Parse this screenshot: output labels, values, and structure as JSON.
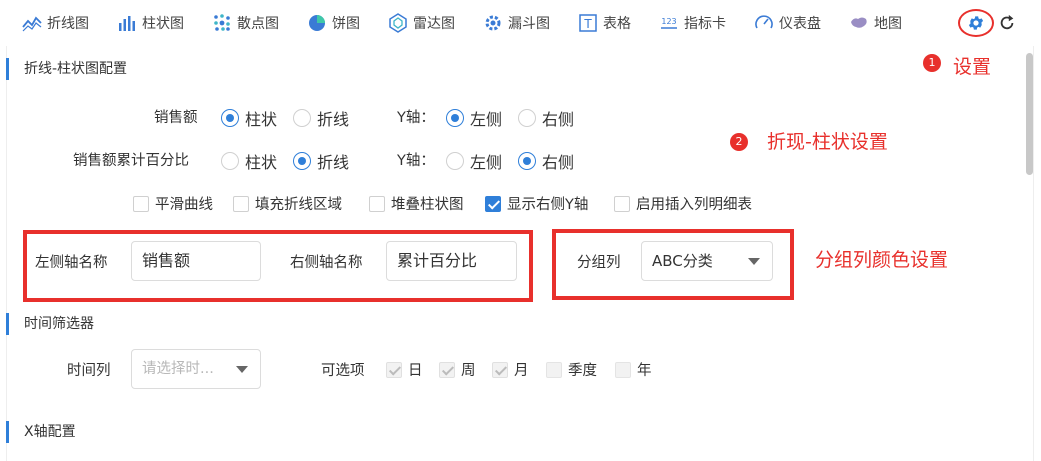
{
  "toolbar": {
    "items": [
      {
        "label": "折线图",
        "icon": "line-chart-icon"
      },
      {
        "label": "柱状图",
        "icon": "bar-chart-icon"
      },
      {
        "label": "散点图",
        "icon": "scatter-chart-icon"
      },
      {
        "label": "饼图",
        "icon": "pie-chart-icon"
      },
      {
        "label": "雷达图",
        "icon": "radar-chart-icon"
      },
      {
        "label": "漏斗图",
        "icon": "funnel-chart-icon"
      },
      {
        "label": "表格",
        "icon": "table-icon"
      },
      {
        "label": "指标卡",
        "icon": "kpi-card-icon"
      },
      {
        "label": "仪表盘",
        "icon": "gauge-icon"
      },
      {
        "label": "地图",
        "icon": "map-icon"
      }
    ],
    "kpi_icon_text": "123",
    "table_icon_text": "T"
  },
  "sections": {
    "combo": "折线-柱状图配置",
    "time_filter": "时间筛选器",
    "x_axis": "X轴配置"
  },
  "series": [
    {
      "name": "销售额",
      "type_options": [
        "柱状",
        "折线"
      ],
      "type_selected": "柱状",
      "yaxis_label": "Y轴：",
      "yaxis_options": [
        "左侧",
        "右侧"
      ],
      "yaxis_selected": "左侧"
    },
    {
      "name": "销售额累计百分比",
      "type_options": [
        "柱状",
        "折线"
      ],
      "type_selected": "折线",
      "yaxis_label": "Y轴：",
      "yaxis_options": [
        "左侧",
        "右侧"
      ],
      "yaxis_selected": "右侧"
    }
  ],
  "options": [
    {
      "label": "平滑曲线",
      "checked": false
    },
    {
      "label": "填充折线区域",
      "checked": false
    },
    {
      "label": "堆叠柱状图",
      "checked": false
    },
    {
      "label": "显示右侧Y轴",
      "checked": true
    },
    {
      "label": "启用插入列明细表",
      "checked": false
    }
  ],
  "axis_names": {
    "left_label": "左侧轴名称",
    "left_value": "销售额",
    "right_label": "右侧轴名称",
    "right_value": "累计百分比"
  },
  "group": {
    "label": "分组列",
    "value": "ABC分类"
  },
  "time": {
    "column_label": "时间列",
    "column_placeholder": "请选择时...",
    "options_label": "可选项",
    "options": [
      {
        "label": "日",
        "checked": true
      },
      {
        "label": "周",
        "checked": true
      },
      {
        "label": "月",
        "checked": true
      },
      {
        "label": "季度",
        "checked": false
      },
      {
        "label": "年",
        "checked": false
      }
    ]
  },
  "annotations": {
    "badge1": "1",
    "text1": "设置",
    "badge2": "2",
    "text2": "折现-柱状设置",
    "text3": "分组列颜色设置"
  },
  "colors": {
    "accent": "#2f7fd9",
    "annotation_red": "#e8302c"
  }
}
